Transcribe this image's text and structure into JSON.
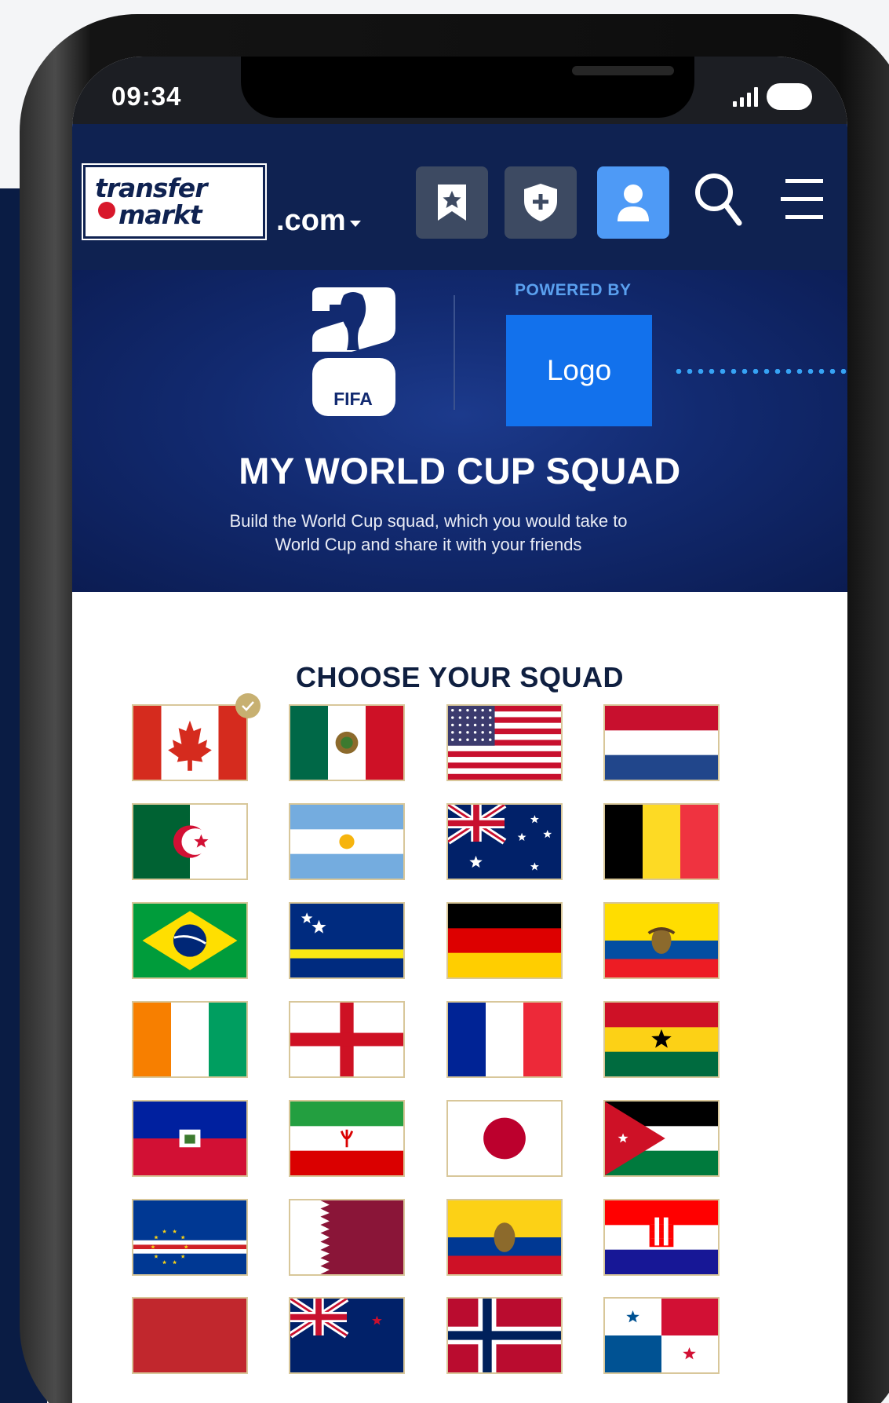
{
  "status_bar": {
    "time": "09:34"
  },
  "header": {
    "logo_line1": "transfer",
    "logo_line2": "markt",
    "domain": ".com"
  },
  "hero": {
    "emblem_text": "FIFA",
    "powered_by": "POWERED BY",
    "sponsor_logo": "Logo",
    "title": "MY WORLD CUP SQUAD",
    "subtitle": "Build the World Cup squad, which you would take to World Cup and share it with your friends"
  },
  "squad": {
    "title": "CHOOSE YOUR SQUAD",
    "selected": "canada",
    "flags": [
      "canada",
      "mexico",
      "usa",
      "netherlands",
      "algeria",
      "argentina",
      "australia",
      "belgium",
      "brazil",
      "curacao",
      "germany",
      "ecuador",
      "ivory-coast",
      "england",
      "france",
      "ghana",
      "haiti",
      "iran",
      "japan",
      "jordan",
      "cape-verde",
      "qatar",
      "colombia",
      "croatia",
      "morocco",
      "new-zealand",
      "norway",
      "panama"
    ]
  },
  "colors": {
    "navy": "#0f2251",
    "accent_blue": "#4e9af6",
    "sponsor_blue": "#1271ec",
    "check_gold": "#c7b071",
    "flag_border": "#d8c79a"
  }
}
